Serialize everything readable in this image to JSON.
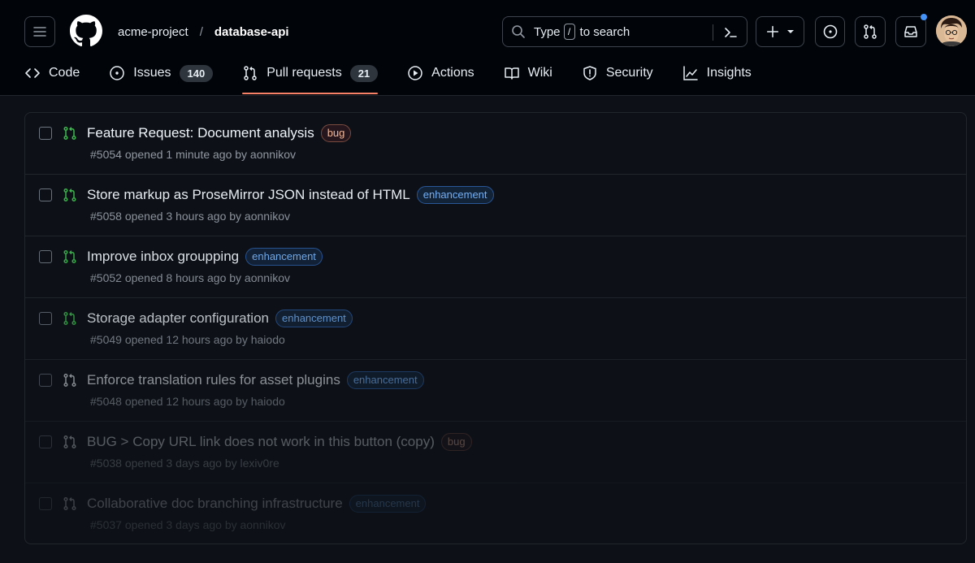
{
  "repo": {
    "owner": "acme-project",
    "separator": "/",
    "name": "database-api"
  },
  "search": {
    "prefix": "Type",
    "key": "/",
    "suffix": "to search"
  },
  "tabs": [
    {
      "label": "Code",
      "icon": "code-icon"
    },
    {
      "label": "Issues",
      "icon": "issue-icon",
      "count": "140"
    },
    {
      "label": "Pull requests",
      "icon": "pull-request-icon",
      "count": "21",
      "active": true
    },
    {
      "label": "Actions",
      "icon": "play-icon"
    },
    {
      "label": "Wiki",
      "icon": "book-icon"
    },
    {
      "label": "Security",
      "icon": "shield-icon"
    },
    {
      "label": "Insights",
      "icon": "graph-icon"
    }
  ],
  "pull_requests": [
    {
      "title": "Feature Request: Document analysis",
      "label": "bug",
      "meta": "#5054 opened 1 minute ago by aonnikov"
    },
    {
      "title": "Store markup as ProseMirror JSON instead of HTML",
      "label": "enhancement",
      "meta": "#5058 opened 3 hours ago by aonnikov"
    },
    {
      "title": "Improve inbox groupping",
      "label": "enhancement",
      "meta": "#5052 opened 8 hours ago by aonnikov"
    },
    {
      "title": "Storage adapter configuration",
      "label": "enhancement",
      "meta": "#5049 opened 12 hours ago by haiodo"
    },
    {
      "title": "Enforce translation rules for asset plugins",
      "label": "enhancement",
      "meta": "#5048 opened 12 hours ago by haiodo"
    },
    {
      "title": "BUG > Copy URL link does not work in this button (copy)",
      "label": "bug",
      "meta": "#5038 opened 3 days ago by lexiv0re"
    },
    {
      "title": "Collaborative doc branching infrastructure",
      "label": "enhancement",
      "meta": "#5037 opened 3 days ago by aonnikov"
    }
  ],
  "colors": {
    "accent": "#f78166",
    "open_pr": "#3fb950",
    "notification": "#4493f8"
  }
}
